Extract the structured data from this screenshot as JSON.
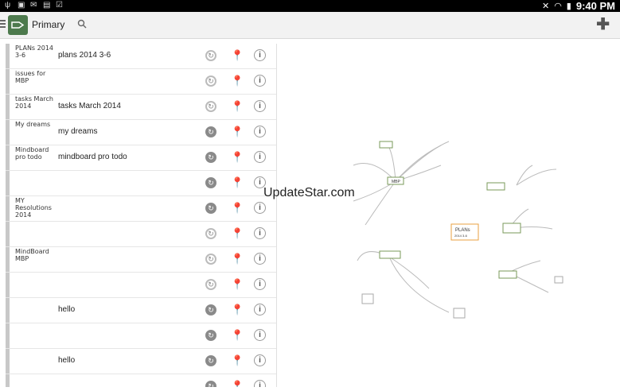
{
  "status_bar": {
    "time": "9:40 PM"
  },
  "action_bar": {
    "title": "Primary",
    "menu_icon": "hamburger-icon",
    "app_icon": "board-logo",
    "search_icon": "search-icon",
    "add_icon": "plus-icon"
  },
  "notes": [
    {
      "thumb": "PLANs 2014 3-6",
      "title": "plans 2014 3-6",
      "sync_active": false,
      "pin_active": false
    },
    {
      "thumb": "issues for MBP",
      "title": "",
      "sync_active": false,
      "pin_active": true
    },
    {
      "thumb": "tasks March 2014",
      "title": "tasks March 2014",
      "sync_active": false,
      "pin_active": true
    },
    {
      "thumb": "My dreams",
      "title": "my dreams",
      "sync_active": true,
      "pin_active": true
    },
    {
      "thumb": "Mindboard pro todo",
      "title": "mindboard pro todo",
      "sync_active": true,
      "pin_active": true
    },
    {
      "thumb": "",
      "title": "",
      "sync_active": true,
      "pin_active": true
    },
    {
      "thumb": "MY Resolutions 2014",
      "title": "",
      "sync_active": true,
      "pin_active": false
    },
    {
      "thumb": "",
      "title": "",
      "sync_active": false,
      "pin_active": false
    },
    {
      "thumb": "MindBoard MBP",
      "title": "",
      "sync_active": false,
      "pin_active": false
    },
    {
      "thumb": "",
      "title": "",
      "sync_active": false,
      "pin_active": false
    },
    {
      "thumb": "",
      "title": "hello",
      "sync_active": true,
      "pin_active": false
    },
    {
      "thumb": "",
      "title": "",
      "sync_active": true,
      "pin_active": false
    },
    {
      "thumb": "",
      "title": "hello",
      "sync_active": true,
      "pin_active": false
    },
    {
      "thumb": "",
      "title": "",
      "sync_active": true,
      "pin_active": false
    }
  ],
  "watermark": "UpdateStar.com",
  "canvas": {
    "nodes": [
      "MBP",
      "PLANs",
      "2014 3-6"
    ]
  }
}
